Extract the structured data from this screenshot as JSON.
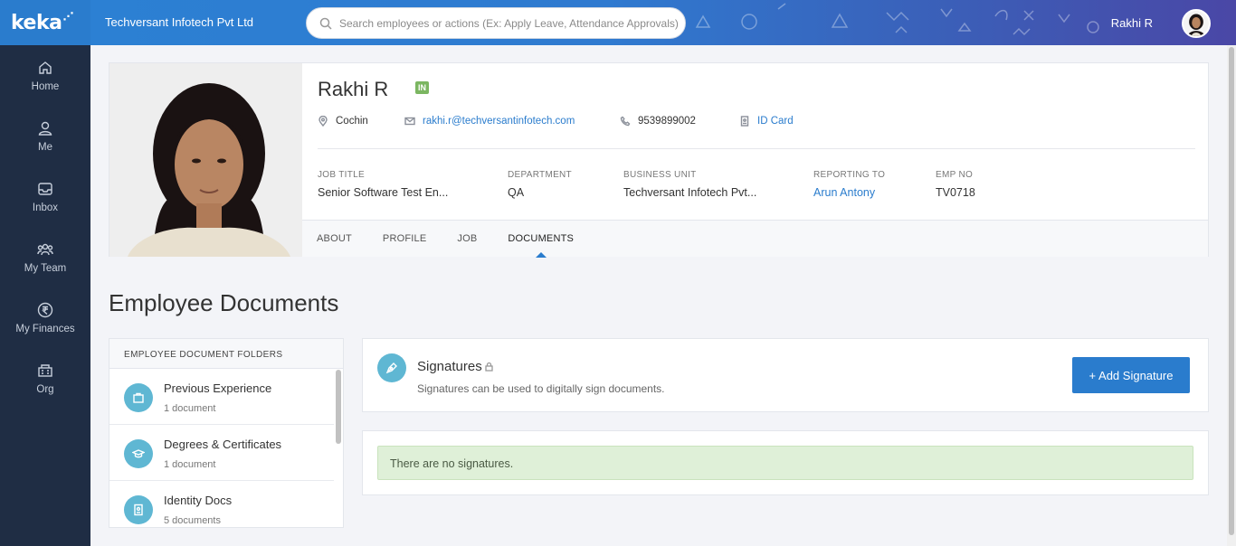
{
  "brand": {
    "logo_text": "keka"
  },
  "sidebar": {
    "items": [
      {
        "label": "Home",
        "icon": "home-icon"
      },
      {
        "label": "Me",
        "icon": "user-icon"
      },
      {
        "label": "Inbox",
        "icon": "inbox-icon"
      },
      {
        "label": "My Team",
        "icon": "team-icon"
      },
      {
        "label": "My Finances",
        "icon": "rupee-icon"
      },
      {
        "label": "Org",
        "icon": "org-icon"
      }
    ]
  },
  "topbar": {
    "company": "Techversant Infotech Pvt Ltd",
    "search_placeholder": "Search employees or actions (Ex: Apply Leave, Attendance Approvals)",
    "user_name": "Rakhi R"
  },
  "profile": {
    "name": "Rakhi R",
    "status_badge": "IN",
    "location": "Cochin",
    "email": "rakhi.r@techversantinfotech.com",
    "phone": "9539899002",
    "id_card": "ID Card",
    "fields": [
      {
        "label": "JOB TITLE",
        "value": "Senior Software Test En...",
        "link": false
      },
      {
        "label": "DEPARTMENT",
        "value": "QA",
        "link": false
      },
      {
        "label": "BUSINESS UNIT",
        "value": "Techversant Infotech Pvt...",
        "link": false
      },
      {
        "label": "REPORTING TO",
        "value": "Arun Antony",
        "link": true
      },
      {
        "label": "EMP NO",
        "value": "TV0718",
        "link": false
      }
    ],
    "tabs": [
      "ABOUT",
      "PROFILE",
      "JOB",
      "DOCUMENTS"
    ],
    "active_tab": "DOCUMENTS"
  },
  "documents": {
    "title": "Employee Documents",
    "folders_header": "EMPLOYEE DOCUMENT FOLDERS",
    "folders": [
      {
        "name": "Previous Experience",
        "count": "1 document",
        "icon": "briefcase-icon"
      },
      {
        "name": "Degrees & Certificates",
        "count": "1 document",
        "icon": "graduation-cap-icon"
      },
      {
        "name": "Identity Docs",
        "count": "5 documents",
        "icon": "id-badge-icon"
      }
    ],
    "signatures": {
      "title": "Signatures",
      "subtitle": "Signatures can be used to digitally sign documents.",
      "add_button": "+ Add Signature",
      "empty_message": "There are no signatures."
    }
  },
  "colors": {
    "accent": "#2a7ccd",
    "sidebar": "#1f2d44",
    "folder_icon": "#5fb7d3",
    "success_bg": "#dff0d8"
  }
}
